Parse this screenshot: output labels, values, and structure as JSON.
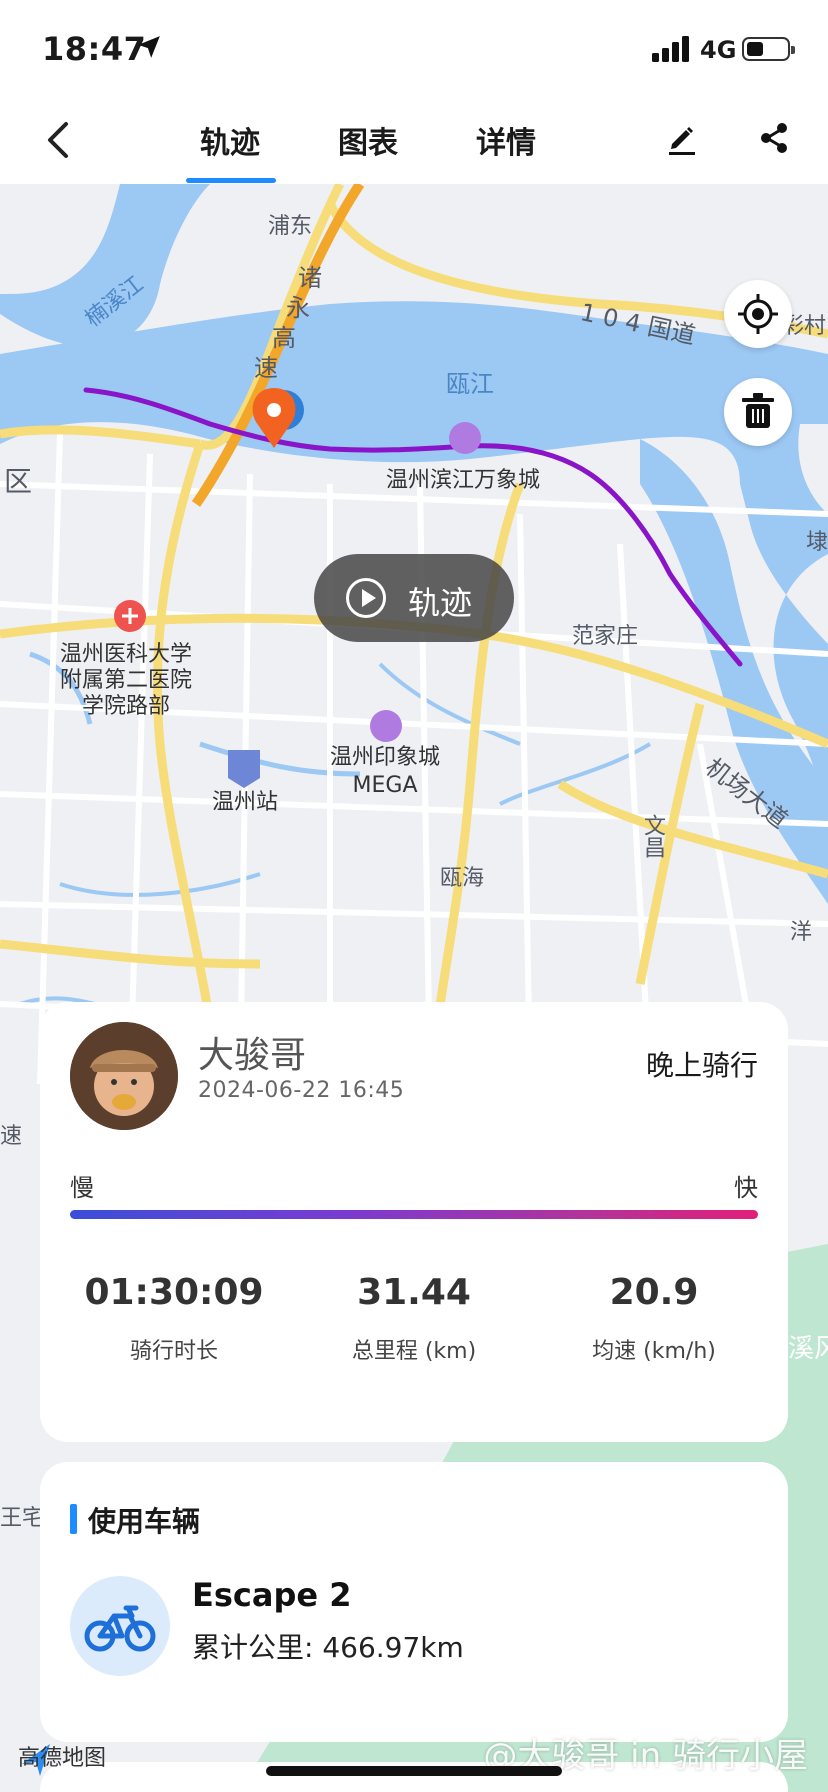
{
  "status_bar": {
    "time": "18:47",
    "network": "4G",
    "icons": [
      "location-arrow-icon",
      "signal-icon",
      "battery-icon"
    ]
  },
  "nav": {
    "tabs": [
      {
        "label": "轨迹",
        "active": true
      },
      {
        "label": "图表",
        "active": false
      },
      {
        "label": "详情",
        "active": false
      }
    ],
    "icons": [
      "back-icon",
      "edit-icon",
      "share-icon"
    ],
    "accent_color": "#1e8bff"
  },
  "map": {
    "labels": {
      "pudong": "浦东",
      "nanxi": "楠溪江",
      "zhuyong1": "诸",
      "zhuyong2": "永",
      "zhuyong3": "高",
      "zhuyong4": "速",
      "road104": "1 0 4 国道",
      "guacai": "挂彩村",
      "oujiang": "瓯江",
      "district": "区",
      "binjiang": "温州滨江万象城",
      "hospital": "温州医科大学\n附属第二医院\n学院路部",
      "fanjiazhuang": "范家庄",
      "yinxiang": "温州印象城\nMEGA",
      "station": "温州站",
      "airport": "机场大道",
      "wenchang": "文昌",
      "ouhai": "瓯海",
      "zhai": "王宅",
      "su": "速",
      "xifeng": "溪风",
      "kan": "埭",
      "yang": "洋"
    },
    "play_label": "轨迹",
    "route_color": "#8a14c8",
    "water_color": "#9cc8f4"
  },
  "ride": {
    "user_name": "大骏哥",
    "datetime": "2024-06-22 16:45",
    "title": "晚上骑行",
    "speed_slow": "慢",
    "speed_fast": "快",
    "stats": [
      {
        "value": "01:30:09",
        "label": "骑行时长"
      },
      {
        "value": "31.44",
        "label": "总里程 (km)"
      },
      {
        "value": "20.9",
        "label": "均速 (km/h)"
      }
    ]
  },
  "vehicle": {
    "section_title": "使用车辆",
    "name": "Escape 2",
    "mileage": "累计公里: 466.97km"
  },
  "footer": {
    "map_logo": "高德地图",
    "watermark": "@大骏哥 in 骑行小屋"
  }
}
